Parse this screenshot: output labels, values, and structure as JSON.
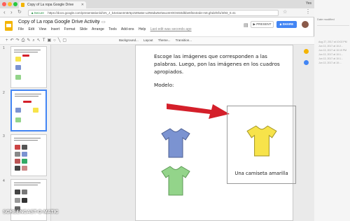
{
  "browser": {
    "tab_title": "Copy of La ropa Google Drive",
    "user": "Yes",
    "secure_label": "Secure",
    "url": "https://docs.google.com/presentation/d/1N_J_k4e4ae4m5r5p1W6a5e-u2N6dw6v0wuvnH0Om50dkbe6f4e4ede-rs8.ghd2/5f1/3/83_0.41"
  },
  "doc": {
    "title": "Copy of La ropa Google Drive Activity",
    "menu": [
      "File",
      "Edit",
      "View",
      "Insert",
      "Format",
      "Slide",
      "Arrange",
      "Tools",
      "Add-ons",
      "Help"
    ],
    "edit_note": "Last edit was seconds ago",
    "present_label": "PRESENT",
    "share_label": "SHARE"
  },
  "toolbar": {
    "items": [
      "Background...",
      "Layout",
      "Theme...",
      "Transition..."
    ]
  },
  "filmstrip": {
    "slides": [
      {
        "num": "1"
      },
      {
        "num": "2"
      },
      {
        "num": "3"
      },
      {
        "num": "4"
      }
    ]
  },
  "slide": {
    "instructions": "Escoge las imágenes que corresponden a las palabras.  Luego, pon las imágenes en los cuadros apropiados.",
    "modelo": "Modelo:",
    "caption": "Una camiseta amarilla"
  },
  "right_panel": {
    "header": "Date modified",
    "entries": [
      "Aug 27, 2017 at 10:02 PM",
      "Jun 13, 2017 at 10:2...",
      "Jun 13, 2017 at 10:19 PM",
      "Jun 13, 2017 at 10:1...",
      "Jun 13, 2017 at 10:1...",
      "Jun 13, 2017 at 10:..."
    ]
  },
  "watermark": "SCREENCAST-O-MATIC",
  "colors": {
    "blue_shirt": "#7b93d1",
    "yellow_shirt": "#f7e34a",
    "green_shirt": "#93d48a",
    "arrow": "#d41f2a",
    "accent": "#4285f4"
  }
}
